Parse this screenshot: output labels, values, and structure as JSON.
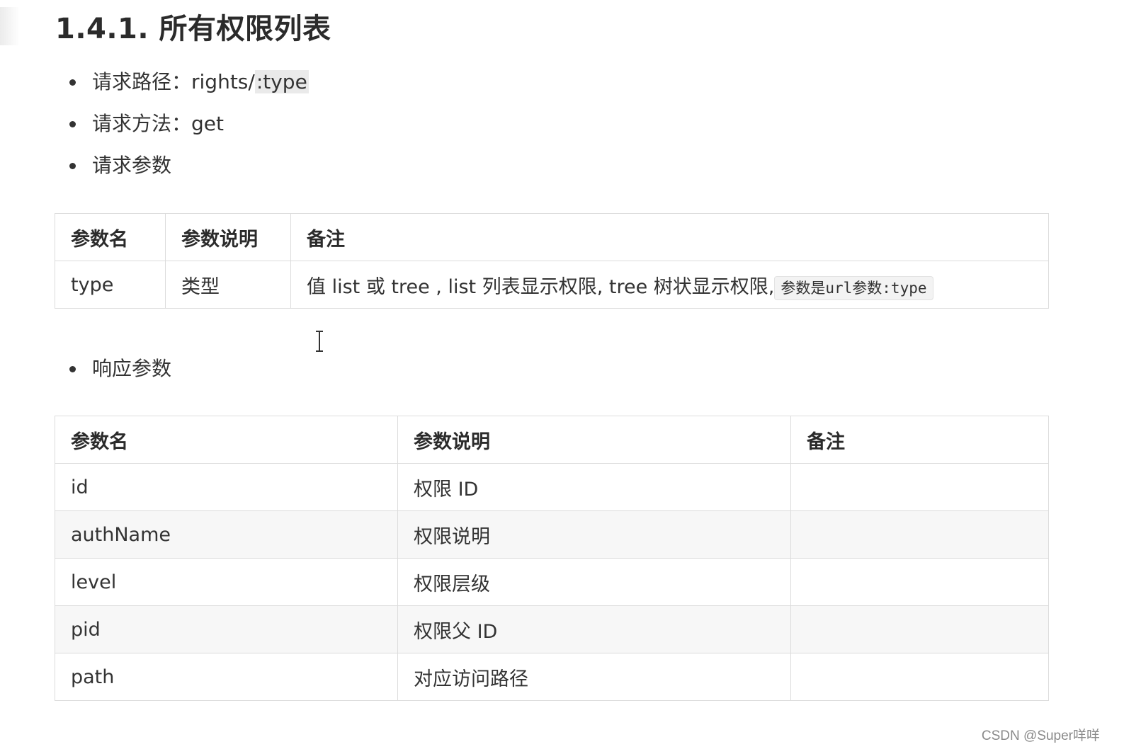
{
  "title": "1.4.1. 所有权限列表",
  "request": {
    "path_label": "请求路径：",
    "path_value_a": "rights/",
    "path_value_b": ":type",
    "method_label": "请求方法：",
    "method_value": "get",
    "params_label": "请求参数"
  },
  "request_table": {
    "headers": [
      "参数名",
      "参数说明",
      "备注"
    ],
    "row": {
      "name": "type",
      "desc": "类型",
      "note": "值 list 或 tree , list 列表显示权限, tree 树状显示权限,",
      "note_code": "参数是url参数:type"
    }
  },
  "response": {
    "params_label": "响应参数"
  },
  "response_table": {
    "headers": [
      "参数名",
      "参数说明",
      "备注"
    ],
    "rows": [
      {
        "name": "id",
        "desc": "权限 ID",
        "note": ""
      },
      {
        "name": "authName",
        "desc": "权限说明",
        "note": ""
      },
      {
        "name": "level",
        "desc": "权限层级",
        "note": ""
      },
      {
        "name": "pid",
        "desc": "权限父 ID",
        "note": ""
      },
      {
        "name": "path",
        "desc": "对应访问路径",
        "note": ""
      }
    ]
  },
  "watermark": "CSDN @Super咩咩",
  "icons": {
    "bullet": "bullet-dot-icon",
    "cursor": "text-cursor-icon"
  }
}
